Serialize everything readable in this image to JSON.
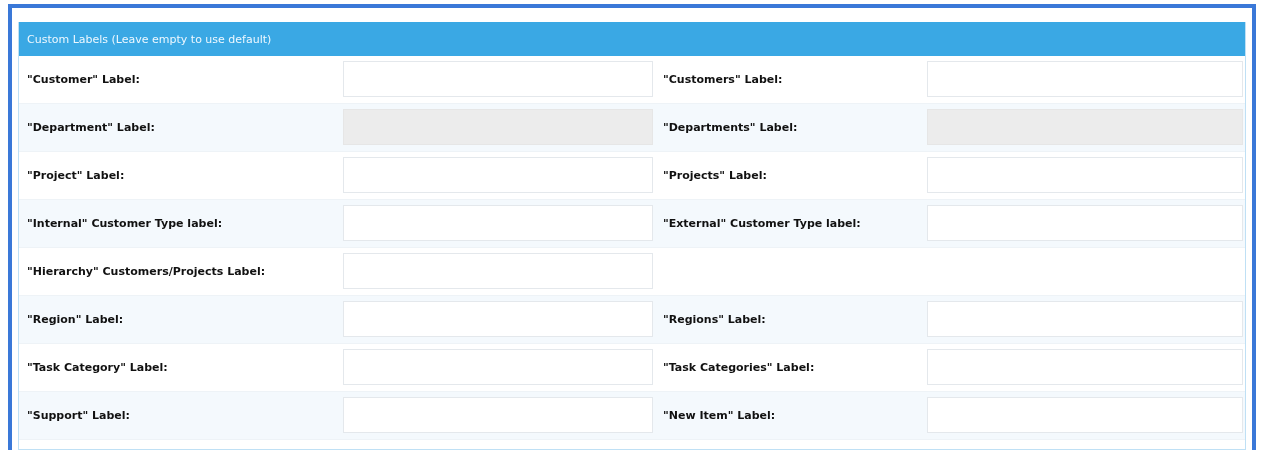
{
  "panel": {
    "title": "Custom Labels (Leave empty to use default)",
    "rows": [
      {
        "cells": [
          {
            "label": "\"Customer\" Label:",
            "disabled": false
          },
          {
            "label": "\"Customers\" Label:",
            "disabled": false
          }
        ]
      },
      {
        "cells": [
          {
            "label": "\"Department\" Label:",
            "disabled": true
          },
          {
            "label": "\"Departments\" Label:",
            "disabled": true
          }
        ]
      },
      {
        "cells": [
          {
            "label": "\"Project\" Label:",
            "disabled": false
          },
          {
            "label": "\"Projects\" Label:",
            "disabled": false
          }
        ]
      },
      {
        "cells": [
          {
            "label": "\"Internal\" Customer Type label:",
            "disabled": false
          },
          {
            "label": "\"External\" Customer Type label:",
            "disabled": false
          }
        ]
      },
      {
        "cells": [
          {
            "label": "\"Hierarchy\" Customers/Projects Label:",
            "disabled": false
          }
        ]
      },
      {
        "cells": [
          {
            "label": "\"Region\" Label:",
            "disabled": false
          },
          {
            "label": "\"Regions\" Label:",
            "disabled": false
          }
        ]
      },
      {
        "cells": [
          {
            "label": "\"Task Category\" Label:",
            "disabled": false
          },
          {
            "label": "\"Task Categories\" Label:",
            "disabled": false
          }
        ]
      },
      {
        "cells": [
          {
            "label": "\"Support\" Label:",
            "disabled": false
          },
          {
            "label": "\"New Item\" Label:",
            "disabled": false
          }
        ]
      }
    ]
  }
}
